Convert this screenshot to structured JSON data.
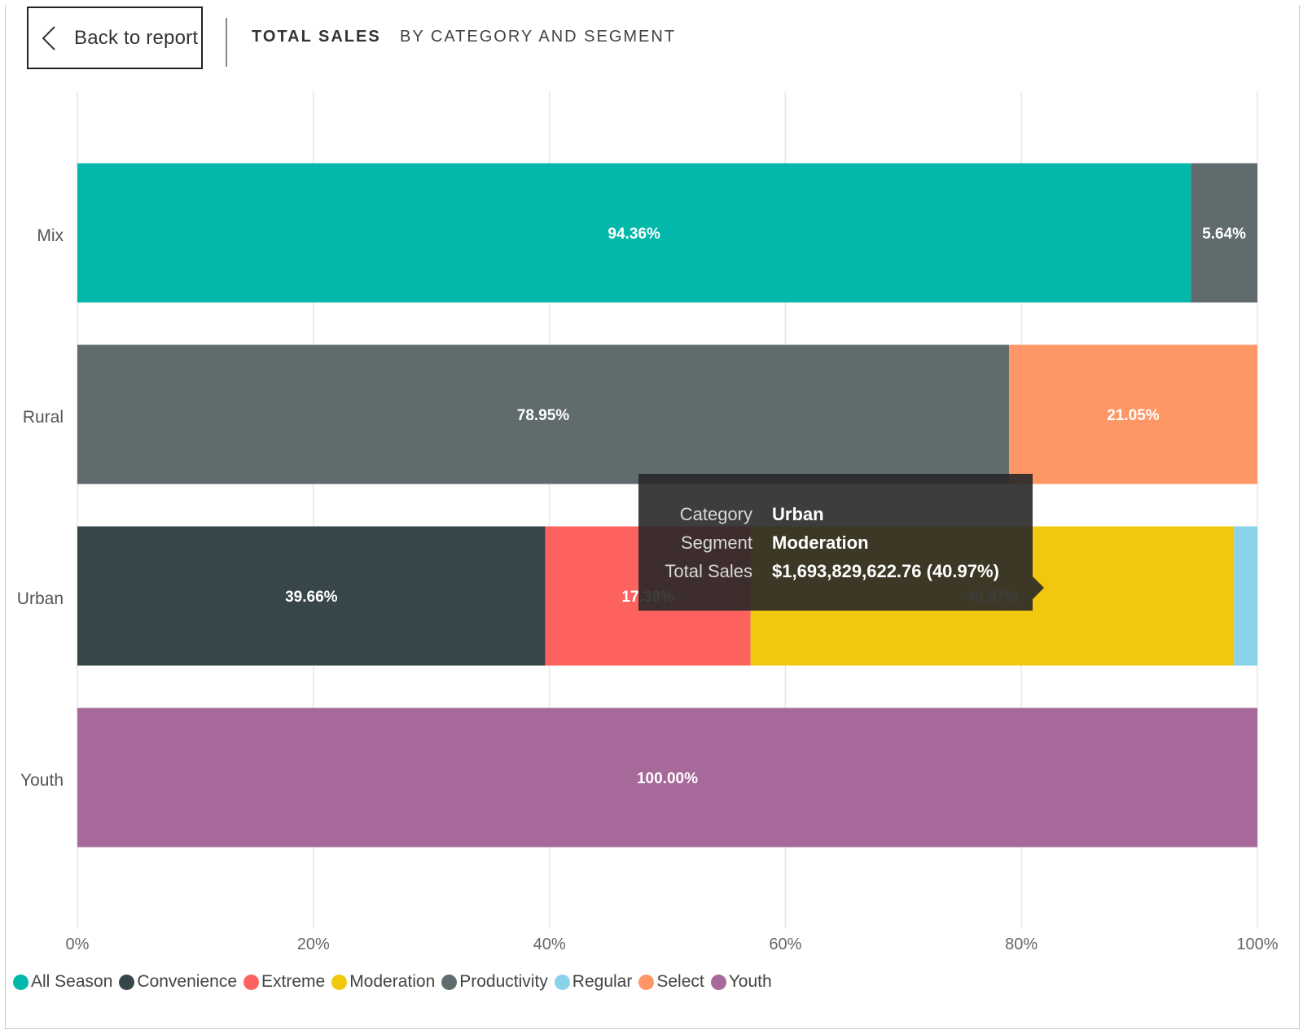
{
  "header": {
    "back_label": "Back to report",
    "title": "TOTAL SALES",
    "subtitle": "BY CATEGORY AND SEGMENT"
  },
  "chart_data": {
    "type": "bar",
    "orientation": "horizontal",
    "stacked": "100%",
    "categories": [
      "Mix",
      "Rural",
      "Urban",
      "Youth"
    ],
    "x_ticks": [
      "0%",
      "20%",
      "40%",
      "60%",
      "80%",
      "100%"
    ],
    "xlim": [
      0,
      100
    ],
    "grid": true,
    "legend_position": "bottom-left",
    "series": [
      {
        "name": "All Season",
        "color": "#01B8AA",
        "values": [
          94.36,
          0,
          0,
          0
        ],
        "labels": [
          "94.36%",
          "",
          "",
          ""
        ]
      },
      {
        "name": "Convenience",
        "color": "#374649",
        "values": [
          0,
          0,
          39.66,
          0
        ],
        "labels": [
          "",
          "",
          "39.66%",
          ""
        ]
      },
      {
        "name": "Extreme",
        "color": "#FD625E",
        "values": [
          0,
          0,
          17.39,
          0
        ],
        "labels": [
          "",
          "",
          "17.39%",
          ""
        ]
      },
      {
        "name": "Moderation",
        "color": "#F2C80F",
        "values": [
          0,
          0,
          40.97,
          0
        ],
        "labels": [
          "",
          "",
          "40.97%",
          ""
        ]
      },
      {
        "name": "Productivity",
        "color": "#5F6B6D",
        "values": [
          5.64,
          78.95,
          0,
          0
        ],
        "labels": [
          "5.64%",
          "78.95%",
          "",
          ""
        ]
      },
      {
        "name": "Regular",
        "color": "#8AD4EB",
        "values": [
          0,
          0,
          1.98,
          0
        ],
        "labels": [
          "",
          "",
          "",
          ""
        ]
      },
      {
        "name": "Select",
        "color": "#FE9666",
        "values": [
          0,
          21.05,
          0,
          0
        ],
        "labels": [
          "",
          "21.05%",
          "",
          ""
        ]
      },
      {
        "name": "Youth",
        "color": "#A66999",
        "values": [
          0,
          0,
          0,
          100.0
        ],
        "labels": [
          "",
          "",
          "",
          "100.00%"
        ]
      }
    ]
  },
  "tooltip": {
    "rows": [
      {
        "key": "Category",
        "value": "Urban"
      },
      {
        "key": "Segment",
        "value": "Moderation"
      },
      {
        "key": "Total Sales",
        "value": "$1,693,829,622.76 (40.97%)"
      }
    ]
  },
  "icons": {
    "back": "chevron-left-icon"
  }
}
